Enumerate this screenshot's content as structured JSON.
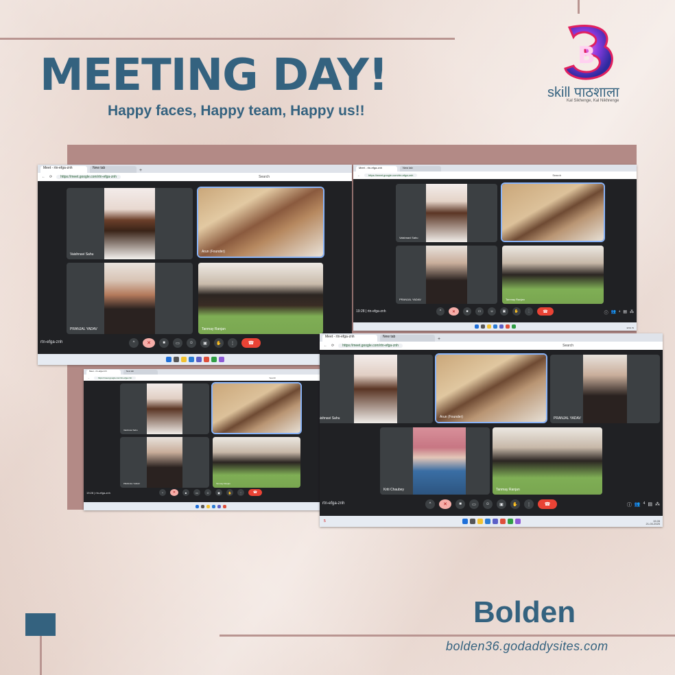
{
  "header": {
    "title": "MEETING DAY!",
    "subtitle": "Happy faces, Happy team, Happy us!!"
  },
  "logo": {
    "mark": "B",
    "name": "skill पाठशाला",
    "tagline": "Kal Sikhenge, Kal Nikhrenge"
  },
  "footer": {
    "brand": "Bolden",
    "url": "bolden36.godaddysites.com"
  },
  "browser": {
    "tab_active": "Meet - rtn-efga-znh",
    "tab_new": "New tab",
    "url": "https://meet.google.com/rtn-efga-znh",
    "search_placeholder": "Search"
  },
  "meeting": {
    "code": "rtn-efga-znh",
    "time": "19:28",
    "clock_time": "19:28",
    "clock_date": "21-03-2025",
    "lang": "ENG IN",
    "notification_count": "4",
    "taskbar_badge": "5"
  },
  "participants": {
    "vaishnavi": "Vaishnavi Sahu",
    "pranjal": "PRANJAL YADAV",
    "tanmay": "Tanmay Ranjan",
    "kriti": "Kriti Chaubey",
    "founder": "Arun (Founder)"
  },
  "colors": {
    "brand_blue": "#34627f",
    "rose_frame": "#b38a86",
    "meet_bg": "#202124",
    "tile_bg": "#3c4043",
    "end_call": "#ea4335"
  }
}
